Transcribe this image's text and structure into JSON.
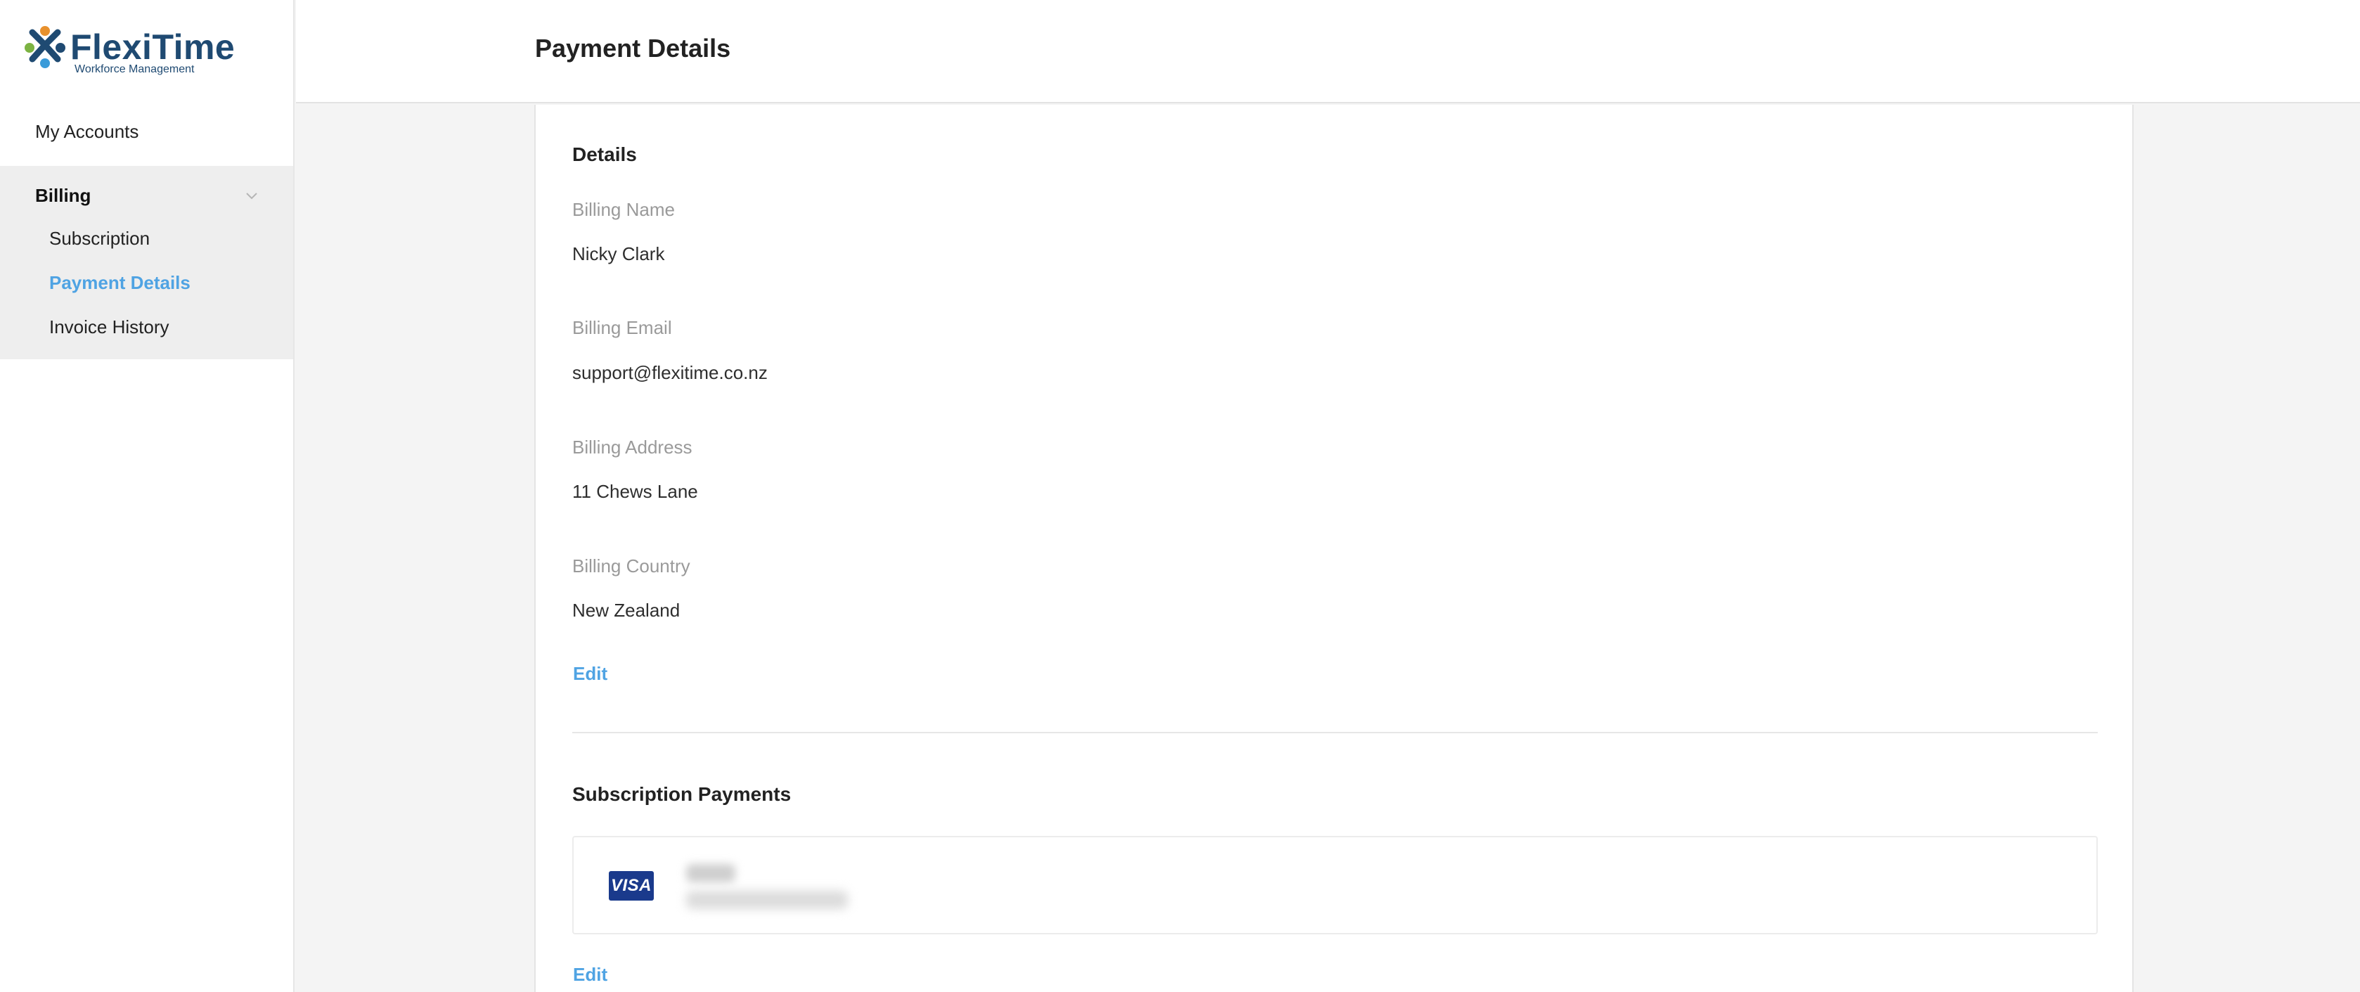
{
  "brand": {
    "name": "FlexiTime",
    "tagline": "Workforce Management"
  },
  "sidebar": {
    "my_accounts": "My Accounts",
    "billing": {
      "label": "Billing",
      "items": [
        {
          "label": "Subscription",
          "active": false
        },
        {
          "label": "Payment Details",
          "active": true
        },
        {
          "label": "Invoice History",
          "active": false
        }
      ]
    }
  },
  "header": {
    "title": "Payment Details"
  },
  "details": {
    "title": "Details",
    "fields": [
      {
        "label": "Billing Name",
        "value": "Nicky Clark"
      },
      {
        "label": "Billing Email",
        "value": "support@flexitime.co.nz"
      },
      {
        "label": "Billing Address",
        "value": "11 Chews Lane"
      },
      {
        "label": "Billing Country",
        "value": "New Zealand"
      }
    ],
    "edit_label": "Edit"
  },
  "subscription_payments": {
    "title": "Subscription Payments",
    "card_brand": "VISA",
    "edit_label": "Edit"
  },
  "colors": {
    "accent": "#4fa3e3",
    "brand": "#1f4a72",
    "visa": "#1a3a8c"
  }
}
